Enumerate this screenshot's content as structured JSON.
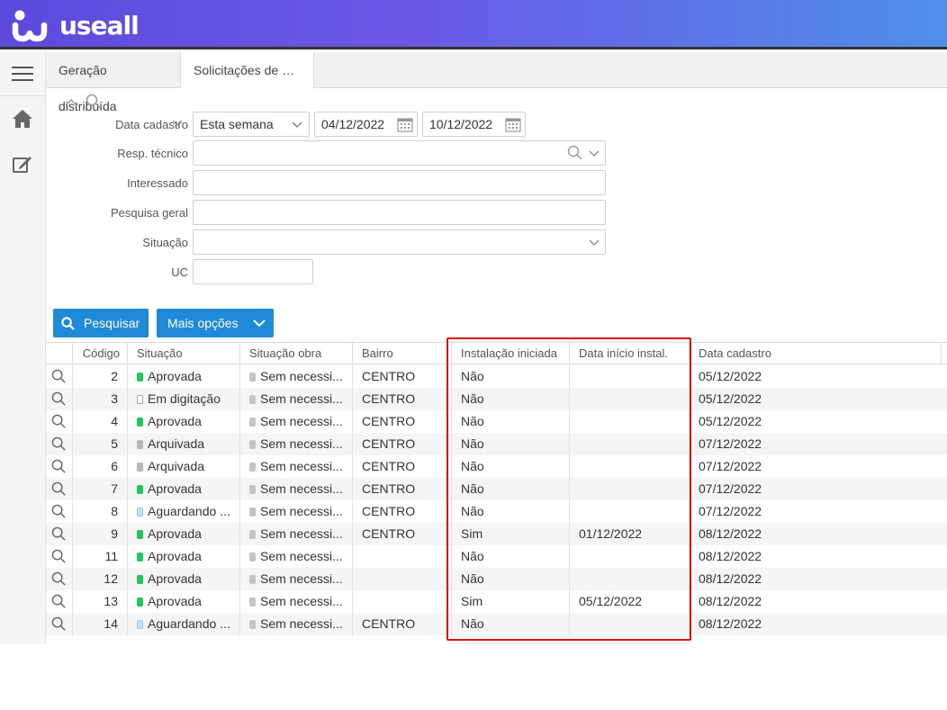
{
  "app": {
    "logo_text": "useall"
  },
  "tabs": [
    {
      "label": "Geração distribuída"
    },
    {
      "label": "Solicitações de ace..."
    }
  ],
  "filters": {
    "data_cadastro_label": "Data cadastro",
    "data_cadastro_period": "Esta semana",
    "date_from": "04/12/2022",
    "date_to": "10/12/2022",
    "resp_tecnico_label": "Resp. técnico",
    "resp_tecnico_value": "",
    "interessado_label": "Interessado",
    "interessado_value": "",
    "pesquisa_geral_label": "Pesquisa geral",
    "pesquisa_geral_value": "",
    "situacao_label": "Situação",
    "situacao_value": "",
    "uc_label": "UC",
    "uc_value": ""
  },
  "buttons": {
    "search_label": "Pesquisar",
    "more_label": "Mais opções"
  },
  "colors": {
    "aprovada": "#22c55e",
    "arquivada": "#b8b8b8",
    "aguardando": "#bfe0f5",
    "digitacao": "#ffffff",
    "sem_necessidade": "#c4c4c4",
    "accent": "#1f8ad8",
    "highlight": "#e01010"
  },
  "table": {
    "columns": [
      "Código",
      "Situação",
      "Situação obra",
      "Bairro",
      "Instalação iniciada",
      "Data início instal.",
      "Data cadastro"
    ],
    "rows": [
      {
        "codigo": "2",
        "situacao": "Aprovada",
        "situacao_status": "aprovada",
        "obra": "Sem necessi...",
        "bairro": "CENTRO",
        "inst": "Não",
        "data_inst": "",
        "data_cad": "05/12/2022"
      },
      {
        "codigo": "3",
        "situacao": "Em digitação",
        "situacao_status": "digitacao",
        "obra": "Sem necessi...",
        "bairro": "CENTRO",
        "inst": "Não",
        "data_inst": "",
        "data_cad": "05/12/2022"
      },
      {
        "codigo": "4",
        "situacao": "Aprovada",
        "situacao_status": "aprovada",
        "obra": "Sem necessi...",
        "bairro": "CENTRO",
        "inst": "Não",
        "data_inst": "",
        "data_cad": "05/12/2022"
      },
      {
        "codigo": "5",
        "situacao": "Arquivada",
        "situacao_status": "arquivada",
        "obra": "Sem necessi...",
        "bairro": "CENTRO",
        "inst": "Não",
        "data_inst": "",
        "data_cad": "07/12/2022"
      },
      {
        "codigo": "6",
        "situacao": "Arquivada",
        "situacao_status": "arquivada",
        "obra": "Sem necessi...",
        "bairro": "CENTRO",
        "inst": "Não",
        "data_inst": "",
        "data_cad": "07/12/2022"
      },
      {
        "codigo": "7",
        "situacao": "Aprovada",
        "situacao_status": "aprovada",
        "obra": "Sem necessi...",
        "bairro": "CENTRO",
        "inst": "Não",
        "data_inst": "",
        "data_cad": "07/12/2022"
      },
      {
        "codigo": "8",
        "situacao": "Aguardando ...",
        "situacao_status": "aguardando",
        "obra": "Sem necessi...",
        "bairro": "CENTRO",
        "inst": "Não",
        "data_inst": "",
        "data_cad": "07/12/2022"
      },
      {
        "codigo": "9",
        "situacao": "Aprovada",
        "situacao_status": "aprovada",
        "obra": "Sem necessi...",
        "bairro": "CENTRO",
        "inst": "Sim",
        "data_inst": "01/12/2022",
        "data_cad": "08/12/2022"
      },
      {
        "codigo": "11",
        "situacao": "Aprovada",
        "situacao_status": "aprovada",
        "obra": "Sem necessi...",
        "bairro": "",
        "inst": "Não",
        "data_inst": "",
        "data_cad": "08/12/2022"
      },
      {
        "codigo": "12",
        "situacao": "Aprovada",
        "situacao_status": "aprovada",
        "obra": "Sem necessi...",
        "bairro": "",
        "inst": "Não",
        "data_inst": "",
        "data_cad": "08/12/2022"
      },
      {
        "codigo": "13",
        "situacao": "Aprovada",
        "situacao_status": "aprovada",
        "obra": "Sem necessi...",
        "bairro": "",
        "inst": "Sim",
        "data_inst": "05/12/2022",
        "data_cad": "08/12/2022"
      },
      {
        "codigo": "14",
        "situacao": "Aguardando ...",
        "situacao_status": "aguardando",
        "obra": "Sem necessi...",
        "bairro": "CENTRO",
        "inst": "Não",
        "data_inst": "",
        "data_cad": "08/12/2022"
      }
    ]
  }
}
